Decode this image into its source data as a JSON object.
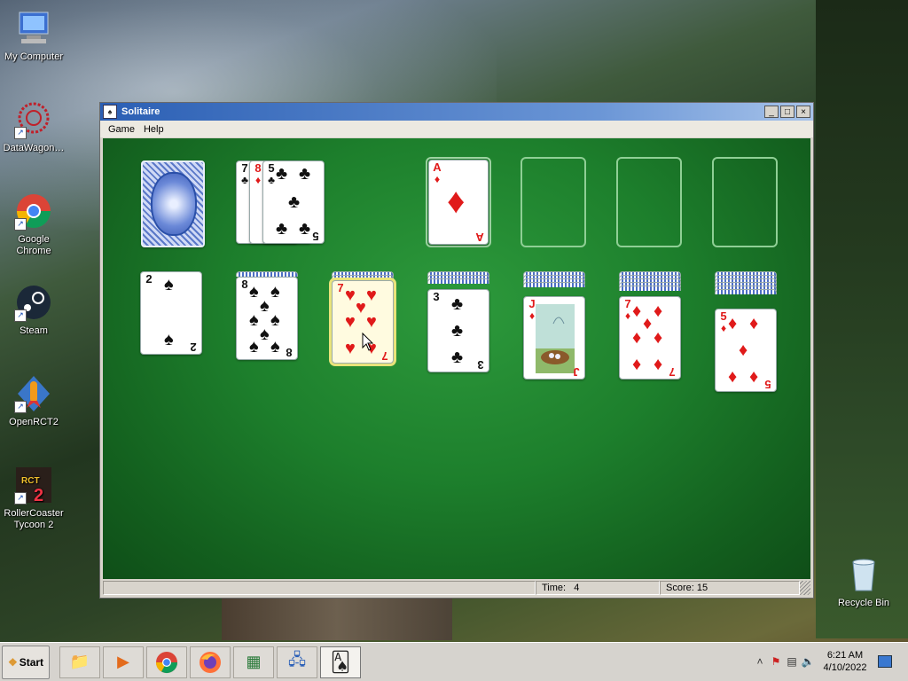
{
  "desktop": {
    "icons": [
      {
        "label": "My Computer",
        "glyph": "🖥"
      },
      {
        "label": "DataWagon…",
        "glyph": "✺"
      },
      {
        "label": "Google Chrome",
        "glyph": "◉"
      },
      {
        "label": "Steam",
        "glyph": "⚙"
      },
      {
        "label": "OpenRCT2",
        "glyph": "🚀"
      },
      {
        "label": "RollerCoaster Tycoon 2",
        "glyph": "2"
      },
      {
        "label": "Recycle Bin",
        "glyph": "🗑"
      }
    ]
  },
  "window": {
    "title": "Solitaire",
    "menu": [
      "Game",
      "Help"
    ],
    "buttons": {
      "minimize": "_",
      "maximize": "□",
      "close": "×"
    }
  },
  "game": {
    "stock": {
      "face_down": true
    },
    "waste": [
      {
        "rank": "7",
        "suit": "♣",
        "color": "black"
      },
      {
        "rank": "8",
        "suit": "♦",
        "color": "red"
      },
      {
        "rank": "5",
        "suit": "♣",
        "color": "black"
      }
    ],
    "foundations": [
      {
        "rank": "A",
        "suit": "♦",
        "color": "red"
      },
      null,
      null,
      null
    ],
    "tableau": [
      {
        "hidden": 0,
        "top": {
          "rank": "2",
          "suit": "♠",
          "color": "black"
        }
      },
      {
        "hidden": 1,
        "top": {
          "rank": "8",
          "suit": "♠",
          "color": "black"
        }
      },
      {
        "hidden": 2,
        "top": {
          "rank": "7",
          "suit": "♥",
          "color": "red"
        },
        "selected": true
      },
      {
        "hidden": 3,
        "top": {
          "rank": "3",
          "suit": "♣",
          "color": "black"
        }
      },
      {
        "hidden": 4,
        "top": {
          "rank": "J",
          "suit": "♦",
          "color": "red"
        }
      },
      {
        "hidden": 5,
        "top": {
          "rank": "7",
          "suit": "♦",
          "color": "red"
        }
      },
      {
        "hidden": 6,
        "top": {
          "rank": "5",
          "suit": "♦",
          "color": "red"
        }
      }
    ]
  },
  "status": {
    "time_label": "Time:",
    "time_value": "4",
    "score_label": "Score:",
    "score_value": "15"
  },
  "taskbar": {
    "start_label": "Start",
    "apps": [
      {
        "name": "explorer",
        "glyph": "📁"
      },
      {
        "name": "media",
        "glyph": "▶"
      },
      {
        "name": "chrome",
        "glyph": "◉"
      },
      {
        "name": "firefox",
        "glyph": "🦊"
      },
      {
        "name": "taskmgr",
        "glyph": "▦"
      },
      {
        "name": "network",
        "glyph": "🖧"
      },
      {
        "name": "solitaire",
        "glyph": "🂡"
      }
    ],
    "clock_time": "6:21 AM",
    "clock_date": "4/10/2022"
  }
}
